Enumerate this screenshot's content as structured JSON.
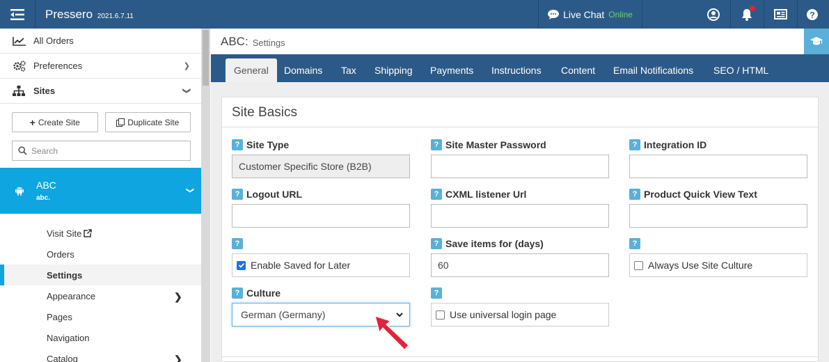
{
  "topbar": {
    "brand": "Pressero",
    "version": "2021.6.7.11",
    "live_chat": "Live Chat",
    "live_status": "Online"
  },
  "sidebar": {
    "items": [
      {
        "label": "All Orders",
        "icon": "chart-line-icon"
      },
      {
        "label": "Preferences",
        "icon": "gears-icon"
      },
      {
        "label": "Sites",
        "icon": "sitemap-icon"
      }
    ],
    "create_site": "Create Site",
    "duplicate_site": "Duplicate Site",
    "search_placeholder": "Search",
    "site": {
      "name": "ABC",
      "sub": "abc."
    },
    "subnav": [
      {
        "label": "Visit Site"
      },
      {
        "label": "Orders"
      },
      {
        "label": "Settings"
      },
      {
        "label": "Appearance"
      },
      {
        "label": "Pages"
      },
      {
        "label": "Navigation"
      },
      {
        "label": "Catalog"
      }
    ]
  },
  "header": {
    "title": "ABC:",
    "subtitle": "Settings"
  },
  "tabs": [
    {
      "label": "General"
    },
    {
      "label": "Domains"
    },
    {
      "label": "Tax"
    },
    {
      "label": "Shipping"
    },
    {
      "label": "Payments"
    },
    {
      "label": "Instructions"
    },
    {
      "label": "Content"
    },
    {
      "label": "Email Notifications"
    },
    {
      "label": "SEO / HTML"
    }
  ],
  "panel": {
    "title": "Site Basics",
    "help": "?",
    "fields": {
      "site_type": {
        "label": "Site Type",
        "value": "Customer Specific Store (B2B)"
      },
      "master_password": {
        "label": "Site Master Password",
        "value": ""
      },
      "integration_id": {
        "label": "Integration ID",
        "value": ""
      },
      "logout_url": {
        "label": "Logout URL",
        "value": ""
      },
      "cxml_url": {
        "label": "CXML listener Url",
        "value": ""
      },
      "quick_view": {
        "label": "Product Quick View Text",
        "value": ""
      },
      "enable_saved": {
        "label": "Enable Saved for Later",
        "checked": true
      },
      "save_days": {
        "label": "Save items for (days)",
        "value": "60"
      },
      "always_culture": {
        "label": "Always Use Site Culture",
        "checked": false
      },
      "culture": {
        "label": "Culture",
        "value": "German (Germany)"
      },
      "universal_login": {
        "label": "Use universal login page",
        "checked": false
      }
    }
  },
  "colors": {
    "nav_blue": "#2c5a88",
    "accent": "#0ea5e0",
    "help_blue": "#5ab0d8",
    "arrow_red": "#e2233b"
  }
}
